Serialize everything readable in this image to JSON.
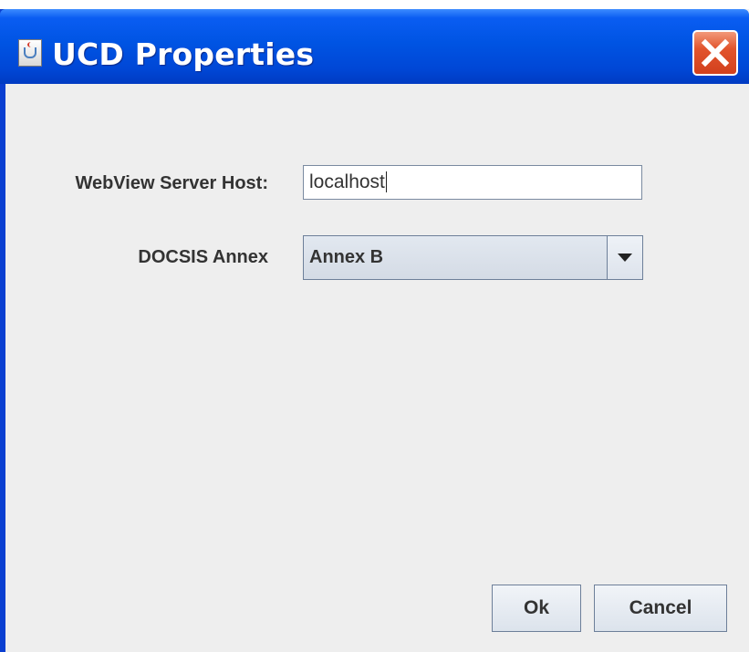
{
  "window": {
    "title": "UCD Properties",
    "title_icon": "java-cup-icon",
    "close_icon": "close-icon",
    "titlebar_color": "#0054e3",
    "close_color": "#e2542d"
  },
  "form": {
    "host_label": "WebView Server Host:",
    "host_value": "localhost",
    "annex_label": "DOCSIS Annex",
    "annex_selected": "Annex B",
    "annex_dropdown_icon": "chevron-down-icon"
  },
  "buttons": {
    "ok_label": "Ok",
    "cancel_label": "Cancel"
  }
}
